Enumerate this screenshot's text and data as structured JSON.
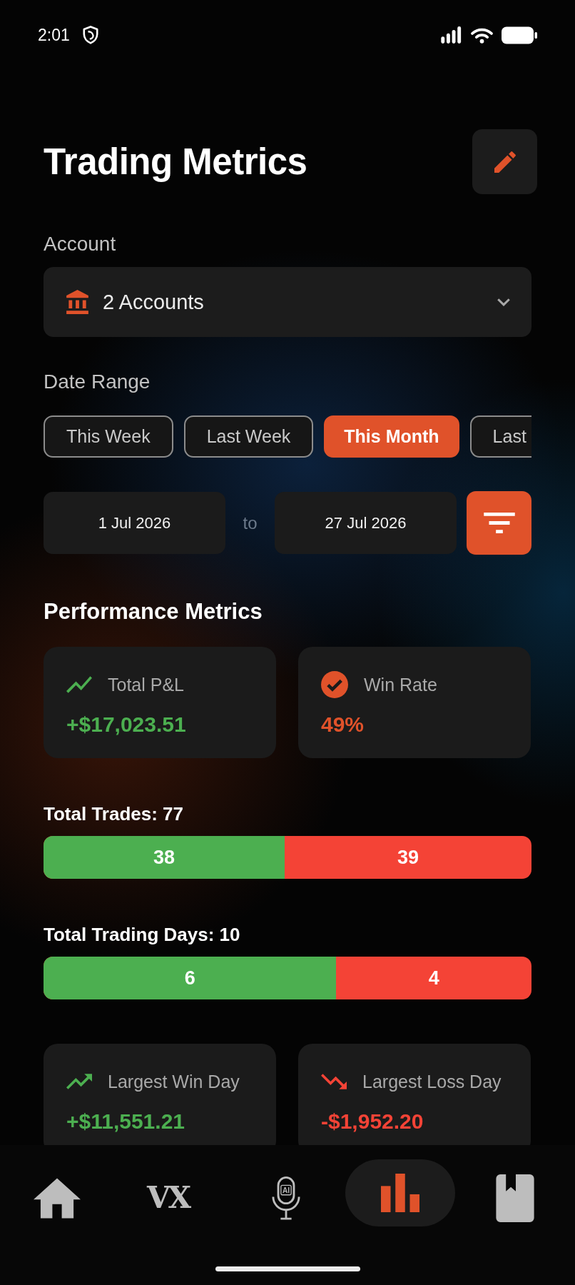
{
  "status_bar": {
    "time": "2:01"
  },
  "header": {
    "title": "Trading Metrics"
  },
  "account": {
    "label": "Account",
    "value": "2 Accounts"
  },
  "date_range": {
    "label": "Date Range",
    "presets": [
      {
        "label": "This Week",
        "selected": false
      },
      {
        "label": "Last Week",
        "selected": false
      },
      {
        "label": "This Month",
        "selected": true
      },
      {
        "label": "Last",
        "selected": false
      }
    ],
    "from": "1 Jul 2026",
    "separator": "to",
    "to": "27 Jul 2026"
  },
  "performance": {
    "title": "Performance Metrics",
    "cards": [
      {
        "kind": "line_chart",
        "label": "Total P&L",
        "value": "+$17,023.51",
        "color": "#4caf50"
      },
      {
        "kind": "check",
        "label": "Win Rate",
        "value": "49%",
        "color": "#e0522a"
      }
    ]
  },
  "splits": [
    {
      "label": "Total Trades: 77",
      "wins": "38",
      "losses": "39",
      "level": 0.494
    },
    {
      "label": "Total Trading Days: 10",
      "wins": "6",
      "losses": "4",
      "level": 0.6
    }
  ],
  "day_cards": [
    {
      "kind": "trend_up",
      "label": "Largest Win Day",
      "value": "+$11,551.21",
      "color": "#4caf50"
    },
    {
      "kind": "trend_down",
      "label": "Largest Loss Day",
      "value": "-$1,952.20",
      "color": "#f44336"
    }
  ],
  "nav": [
    {
      "kind": "home",
      "selected": false
    },
    {
      "kind": "logo",
      "text": "VX",
      "selected": false
    },
    {
      "kind": "mic",
      "badge": "AI",
      "selected": false
    },
    {
      "kind": "chart",
      "selected": true
    },
    {
      "kind": "journal",
      "selected": false
    }
  ]
}
